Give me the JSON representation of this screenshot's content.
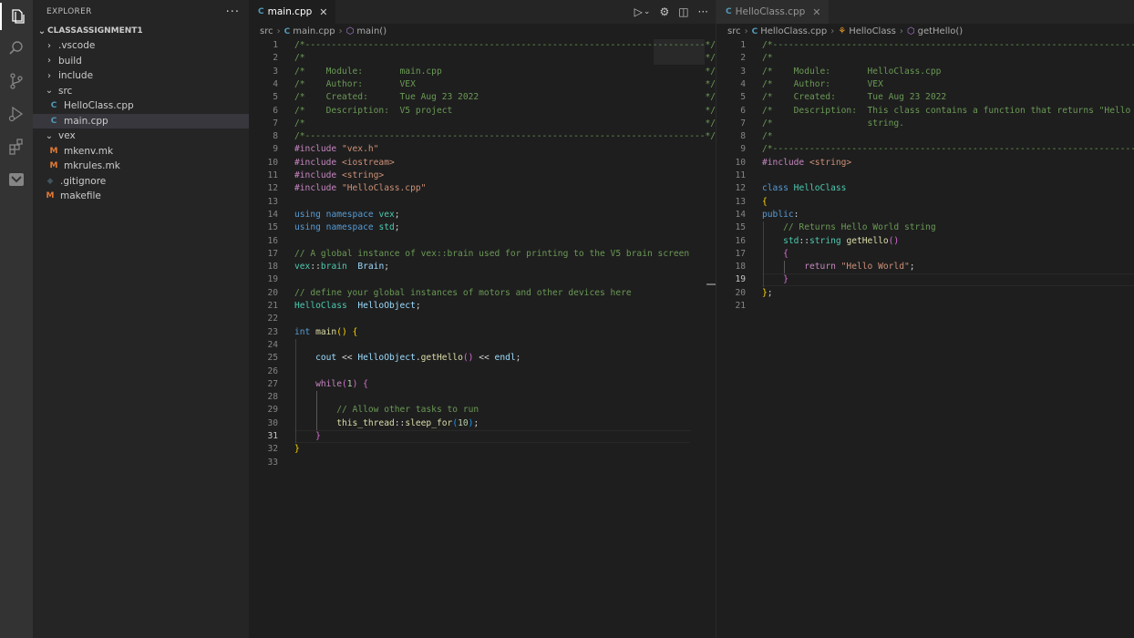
{
  "sidebar": {
    "title": "EXPLORER",
    "more": "···",
    "project": "CLASSASSIGNMENT1",
    "tree": [
      {
        "label": ".vscode",
        "kind": "folder",
        "open": false,
        "depth": 0
      },
      {
        "label": "build",
        "kind": "folder",
        "open": false,
        "depth": 0
      },
      {
        "label": "include",
        "kind": "folder",
        "open": false,
        "depth": 0
      },
      {
        "label": "src",
        "kind": "folder",
        "open": true,
        "depth": 0
      },
      {
        "label": "HelloClass.cpp",
        "kind": "cpp",
        "depth": 1
      },
      {
        "label": "main.cpp",
        "kind": "cpp",
        "depth": 1,
        "selected": true
      },
      {
        "label": "vex",
        "kind": "folder",
        "open": true,
        "depth": 0
      },
      {
        "label": "mkenv.mk",
        "kind": "mk",
        "depth": 1
      },
      {
        "label": "mkrules.mk",
        "kind": "mk",
        "depth": 1
      },
      {
        "label": ".gitignore",
        "kind": "git",
        "depth": 0
      },
      {
        "label": "makefile",
        "kind": "mk",
        "depth": 0
      }
    ]
  },
  "icons": {
    "cpp": "C",
    "mk": "M",
    "git": "◆",
    "chevron_right": "›",
    "chevron_down": "⌄",
    "activity": [
      "files-icon",
      "search-icon",
      "source-control-icon",
      "run-debug-icon",
      "extensions-icon",
      "vex-icon"
    ]
  },
  "colors": {
    "comment": "#6a9955",
    "keyword": "#569cd6",
    "type": "#4ec9b0",
    "function": "#dcdcaa",
    "string": "#ce9178",
    "preprocessor": "#c586c0",
    "variable": "#9cdcfe",
    "number": "#b5cea8"
  },
  "editor_left": {
    "tab": {
      "label": "main.cpp",
      "close": "✕"
    },
    "actions": {
      "run": "▷",
      "run_dropdown": "⌄",
      "settings": "⚙",
      "split": "◫",
      "more": "···"
    },
    "breadcrumb": [
      "src",
      "main.cpp",
      "main()"
    ],
    "current_line": 31,
    "lines": [
      [
        [
          "cm",
          "/*----------------------------------------------------------------------------*/"
        ]
      ],
      [
        [
          "cm",
          "/*                                                                            */"
        ]
      ],
      [
        [
          "cm",
          "/*    Module:       main.cpp                                                  */"
        ]
      ],
      [
        [
          "cm",
          "/*    Author:       VEX                                                       */"
        ]
      ],
      [
        [
          "cm",
          "/*    Created:      Tue Aug 23 2022                                           */"
        ]
      ],
      [
        [
          "cm",
          "/*    Description:  V5 project                                                */"
        ]
      ],
      [
        [
          "cm",
          "/*                                                                            */"
        ]
      ],
      [
        [
          "cm",
          "/*----------------------------------------------------------------------------*/"
        ]
      ],
      [
        [
          "pp",
          "#include "
        ],
        [
          "st",
          "\"vex.h\""
        ]
      ],
      [
        [
          "pp",
          "#include "
        ],
        [
          "st",
          "<iostream>"
        ]
      ],
      [
        [
          "pp",
          "#include "
        ],
        [
          "st",
          "<string>"
        ]
      ],
      [
        [
          "pp",
          "#include "
        ],
        [
          "st",
          "\"HelloClass.cpp\""
        ]
      ],
      [],
      [
        [
          "kw",
          "using"
        ],
        [
          "pl",
          " "
        ],
        [
          "kw",
          "namespace"
        ],
        [
          "pl",
          " "
        ],
        [
          "ty",
          "vex"
        ],
        [
          "pl",
          ";"
        ]
      ],
      [
        [
          "kw",
          "using"
        ],
        [
          "pl",
          " "
        ],
        [
          "kw",
          "namespace"
        ],
        [
          "pl",
          " "
        ],
        [
          "ty",
          "std"
        ],
        [
          "pl",
          ";"
        ]
      ],
      [],
      [
        [
          "cm",
          "// A global instance of vex::brain used for printing to the V5 brain screen"
        ]
      ],
      [
        [
          "ty",
          "vex"
        ],
        [
          "pl",
          "::"
        ],
        [
          "ty",
          "brain"
        ],
        [
          "pl",
          "  "
        ],
        [
          "vr",
          "Brain"
        ],
        [
          "pl",
          ";"
        ]
      ],
      [],
      [
        [
          "cm",
          "// define your global instances of motors and other devices here"
        ]
      ],
      [
        [
          "ty",
          "HelloClass"
        ],
        [
          "pl",
          "  "
        ],
        [
          "vr",
          "HelloObject"
        ],
        [
          "pl",
          ";"
        ]
      ],
      [],
      [
        [
          "kw",
          "int"
        ],
        [
          "pl",
          " "
        ],
        [
          "fn",
          "main"
        ],
        [
          "br1",
          "()"
        ],
        [
          "pl",
          " "
        ],
        [
          "br1",
          "{"
        ]
      ],
      [],
      [
        [
          "pl",
          "    "
        ],
        [
          "vr",
          "cout"
        ],
        [
          "pl",
          " << "
        ],
        [
          "vr",
          "HelloObject"
        ],
        [
          "pl",
          "."
        ],
        [
          "fn",
          "getHello"
        ],
        [
          "br2",
          "()"
        ],
        [
          "pl",
          " << "
        ],
        [
          "vr",
          "endl"
        ],
        [
          "pl",
          ";"
        ]
      ],
      [],
      [
        [
          "pl",
          "    "
        ],
        [
          "pp",
          "while"
        ],
        [
          "br2",
          "("
        ],
        [
          "nm",
          "1"
        ],
        [
          "br2",
          ")"
        ],
        [
          "pl",
          " "
        ],
        [
          "br2",
          "{"
        ]
      ],
      [],
      [
        [
          "pl",
          "        "
        ],
        [
          "cm",
          "// Allow other tasks to run"
        ]
      ],
      [
        [
          "pl",
          "        "
        ],
        [
          "fn",
          "this_thread"
        ],
        [
          "pl",
          "::"
        ],
        [
          "fn",
          "sleep_for"
        ],
        [
          "br3",
          "("
        ],
        [
          "nm",
          "10"
        ],
        [
          "br3",
          ")"
        ],
        [
          "pl",
          ";"
        ]
      ],
      [
        [
          "pl",
          "    "
        ],
        [
          "br2",
          "}"
        ]
      ],
      [
        [
          "br1",
          "}"
        ]
      ],
      []
    ]
  },
  "editor_right": {
    "tab": {
      "label": "HelloClass.cpp",
      "close": "✕"
    },
    "breadcrumb": [
      "src",
      "HelloClass.cpp",
      "HelloClass",
      "getHello()"
    ],
    "current_line": 19,
    "lines": [
      [
        [
          "cm",
          "/*----------------------------------------------------------------------------*/"
        ]
      ],
      [
        [
          "cm",
          "/*                                                                            */"
        ]
      ],
      [
        [
          "cm",
          "/*    Module:       HelloClass.cpp                                            */"
        ]
      ],
      [
        [
          "cm",
          "/*    Author:       VEX                                                       */"
        ]
      ],
      [
        [
          "cm",
          "/*    Created:      Tue Aug 23 2022                                           */"
        ]
      ],
      [
        [
          "cm",
          "/*    Description:  This class contains a function that returns \"Hello World\" */"
        ]
      ],
      [
        [
          "cm",
          "/*                  string.                                                   */"
        ]
      ],
      [
        [
          "cm",
          "/*                                                                            */"
        ]
      ],
      [
        [
          "cm",
          "/*----------------------------------------------------------------------------*/"
        ]
      ],
      [
        [
          "pp",
          "#include "
        ],
        [
          "st",
          "<string>"
        ]
      ],
      [],
      [
        [
          "kw",
          "class"
        ],
        [
          "pl",
          " "
        ],
        [
          "ty",
          "HelloClass"
        ]
      ],
      [
        [
          "br1",
          "{"
        ]
      ],
      [
        [
          "kw",
          "public"
        ],
        [
          "pl",
          ":"
        ]
      ],
      [
        [
          "pl",
          "    "
        ],
        [
          "cm",
          "// Returns Hello World string"
        ]
      ],
      [
        [
          "pl",
          "    "
        ],
        [
          "ty",
          "std"
        ],
        [
          "pl",
          "::"
        ],
        [
          "ty",
          "string"
        ],
        [
          "pl",
          " "
        ],
        [
          "fn",
          "getHello"
        ],
        [
          "br2",
          "()"
        ]
      ],
      [
        [
          "pl",
          "    "
        ],
        [
          "br2",
          "{"
        ]
      ],
      [
        [
          "pl",
          "        "
        ],
        [
          "pp",
          "return"
        ],
        [
          "pl",
          " "
        ],
        [
          "st",
          "\"Hello World\""
        ],
        [
          "pl",
          ";"
        ]
      ],
      [
        [
          "pl",
          "    "
        ],
        [
          "br2",
          "}"
        ]
      ],
      [
        [
          "br1",
          "}"
        ],
        [
          "pl",
          ";"
        ]
      ],
      []
    ]
  }
}
